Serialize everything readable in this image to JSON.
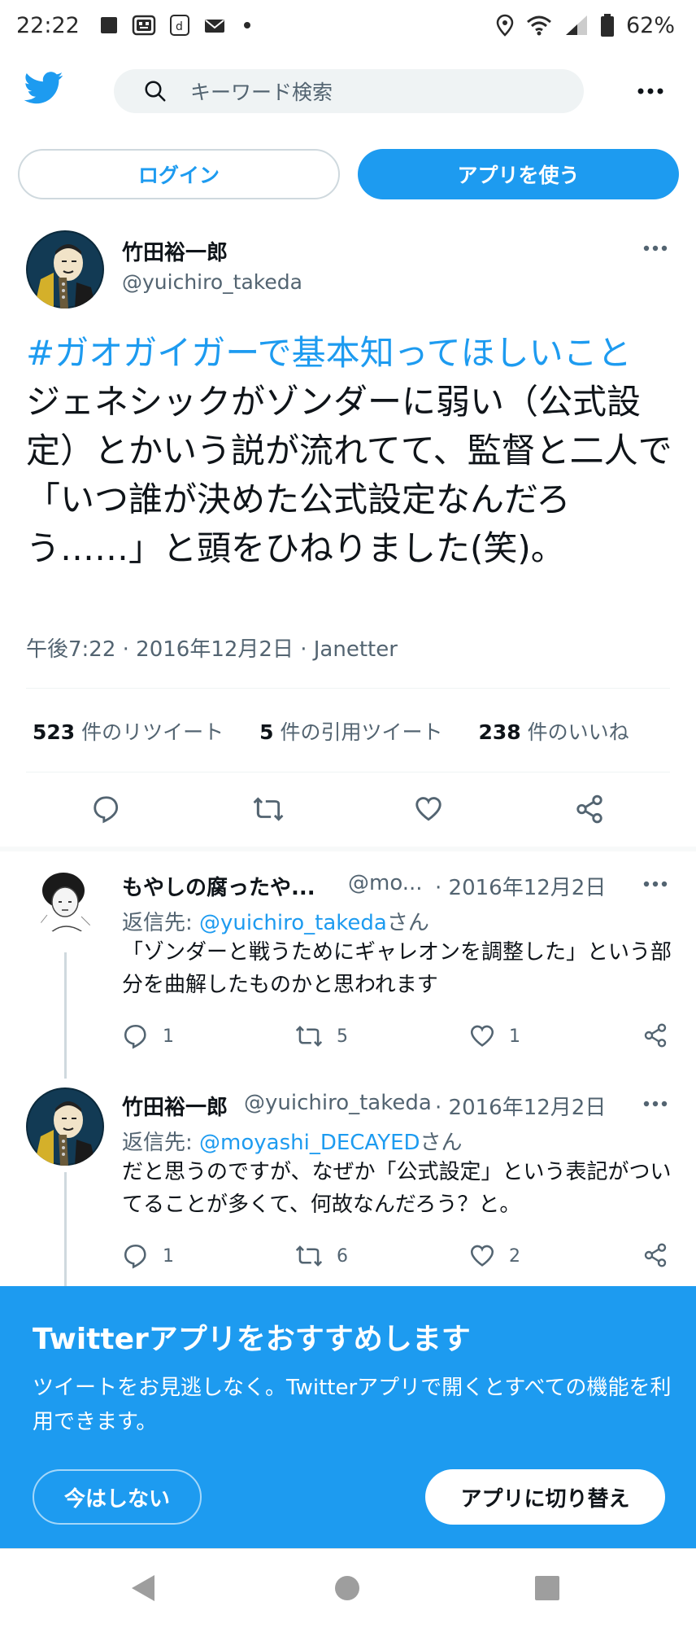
{
  "status_bar": {
    "time": "22:22",
    "battery": "62%",
    "icon_names": [
      "square-notification-icon",
      "robot-app-icon",
      "d-app-icon",
      "mail-icon",
      "dot-icon",
      "location-icon",
      "wifi-icon",
      "signal-icon",
      "battery-icon"
    ]
  },
  "header": {
    "search_placeholder": "キーワード検索",
    "logo_icon": "twitter-bird-icon",
    "more_icon": "more-horizontal-icon"
  },
  "auth": {
    "login_label": "ログイン",
    "app_label": "アプリを使う"
  },
  "tweet": {
    "author_name": "竹田裕一郎",
    "author_handle": "@yuichiro_takeda",
    "hashtag": "#ガオガイガーで基本知ってほしいこと",
    "text": "　ジェネシックがゾンダーに弱い（公式設定）とかいう説が流れてて、監督と二人で「いつ誰が決めた公式設定なんだろう……」と頭をひねりました(笑)。",
    "meta": "午後7:22 · 2016年12月2日 · Janetter",
    "retweets": "523",
    "retweets_label": " 件のリツイート",
    "quotes": "5",
    "quotes_label": " 件の引用ツイート",
    "likes": "238",
    "likes_label": " 件のいいね"
  },
  "replies": [
    {
      "name": "もやしの腐ったや...",
      "handle": "@mo...",
      "date": "· 2016年12月2日",
      "reply_to_prefix": "返信先: ",
      "reply_to_user": "@yuichiro_takeda",
      "reply_to_suffix": "さん",
      "text": "「ゾンダーと戦うためにギャレオンを調整した」という部分を曲解したものかと思われます",
      "reply_count": "1",
      "retweet_count": "5",
      "like_count": "1"
    },
    {
      "name": "竹田裕一郎",
      "handle": "@yuichiro_takeda",
      "date": "· 2016年12月2日",
      "reply_to_prefix": "返信先: ",
      "reply_to_user": "@moyashi_DECAYED",
      "reply_to_suffix": "さん",
      "text": "だと思うのですが、なぜか「公式設定」という表記がついてることが多くて、何故なんだろう？と。",
      "reply_count": "1",
      "retweet_count": "6",
      "like_count": "2"
    }
  ],
  "promo": {
    "title": "Twitterアプリをおすすめします",
    "description": "ツイートをお見逃しなく。Twitterアプリで開くとすべての機能を利用できます。",
    "not_now_label": "今はしない",
    "switch_label": "アプリに切り替え"
  },
  "colors": {
    "brand_blue": "#1d9bf0",
    "text_primary": "#0f1419",
    "text_secondary": "#536471",
    "divider": "#eff3f4"
  }
}
